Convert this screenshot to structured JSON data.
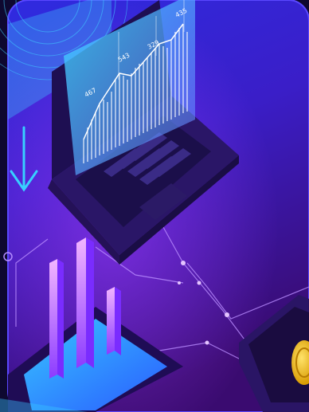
{
  "screen_labels": {
    "label_1": "467",
    "label_2": "543",
    "label_3": "329",
    "label_4": "435"
  },
  "colors": {
    "background_top": "#2f1fd0",
    "background_bottom": "#3b0b78",
    "neon_cyan": "#39d5ff",
    "neon_purple": "#c56cff",
    "laptop_body": "#2a1565",
    "keyboard": "#1b0f4a",
    "coin_gold": "#f0c21a"
  }
}
